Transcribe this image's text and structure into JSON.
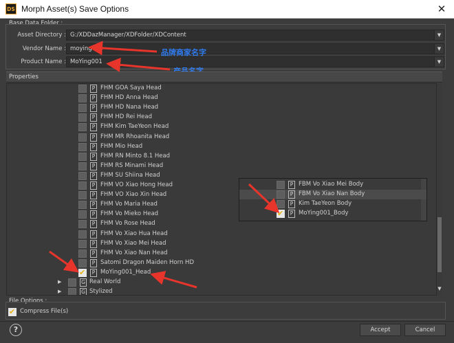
{
  "window": {
    "app_icon_text": "DS",
    "title": "Morph Asset(s) Save Options",
    "close_label": "✕"
  },
  "base_data_folder": {
    "section_label": "Base Data Folder :",
    "asset_directory": {
      "label": "Asset Directory :",
      "value": "G:/XDDazManager/XDFolder/XDContent"
    },
    "vendor_name": {
      "label": "Vendor Name :",
      "value": "moying"
    },
    "product_name": {
      "label": "Product Name :",
      "value": "MoYing001"
    }
  },
  "annotations": {
    "vendor_note": "品牌商家名字",
    "product_note": "产品名字"
  },
  "properties": {
    "header": "Properties",
    "items": [
      {
        "label": "FHM GOA Saya Head",
        "checked": false,
        "type": "P"
      },
      {
        "label": "FHM HD Anna Head",
        "checked": false,
        "type": "P"
      },
      {
        "label": "FHM HD Nana Head",
        "checked": false,
        "type": "P"
      },
      {
        "label": "FHM HD Rei Head",
        "checked": false,
        "type": "P"
      },
      {
        "label": "FHM Kim TaeYeon Head",
        "checked": false,
        "type": "P"
      },
      {
        "label": "FHM MR Rhoanita Head",
        "checked": false,
        "type": "P"
      },
      {
        "label": "FHM Mio Head",
        "checked": false,
        "type": "P"
      },
      {
        "label": "FHM RN Minto 8.1 Head",
        "checked": false,
        "type": "P"
      },
      {
        "label": "FHM RS Minami Head",
        "checked": false,
        "type": "P"
      },
      {
        "label": "FHM SU Shiina Head",
        "checked": false,
        "type": "P"
      },
      {
        "label": "FHM VO Xiao Hong Head",
        "checked": false,
        "type": "P"
      },
      {
        "label": "FHM VO Xiao Xin Head",
        "checked": false,
        "type": "P"
      },
      {
        "label": "FHM Vo Maria Head",
        "checked": false,
        "type": "P"
      },
      {
        "label": "FHM Vo Mieko Head",
        "checked": false,
        "type": "P"
      },
      {
        "label": "FHM Vo Rose Head",
        "checked": false,
        "type": "P"
      },
      {
        "label": "FHM Vo Xiao Hua Head",
        "checked": false,
        "type": "P"
      },
      {
        "label": "FHM Vo Xiao Mei Head",
        "checked": false,
        "type": "P"
      },
      {
        "label": "FHM Vo Xiao Nan Head",
        "checked": false,
        "type": "P"
      },
      {
        "label": "Satomi Dragon Maiden Horn HD",
        "checked": false,
        "type": "P"
      },
      {
        "label": "MoYing001_Head",
        "checked": true,
        "type": "P"
      }
    ],
    "groups": [
      {
        "label": "Real World",
        "type": "G"
      },
      {
        "label": "Stylized",
        "type": "G"
      }
    ],
    "inset_items": [
      {
        "label": "FBM Vo Xiao Mei Body",
        "checked": false,
        "type": "P"
      },
      {
        "label": "FBM Vo Xiao Nan Body",
        "checked": false,
        "type": "P"
      },
      {
        "label": "Kim TaeYeon Body",
        "checked": false,
        "type": "P"
      },
      {
        "label": "MoYing001_Body",
        "checked": true,
        "type": "P"
      }
    ]
  },
  "file_options": {
    "section_label": "File Options :",
    "compress_label": "Compress File(s)",
    "compress_checked": true
  },
  "footer": {
    "help_label": "?",
    "accept_label": "Accept",
    "cancel_label": "Cancel"
  },
  "colors": {
    "annotation_text": "#2f7bf0",
    "arrow": "#e8352b",
    "check": "#e7b416",
    "background": "#3c3c3c"
  }
}
